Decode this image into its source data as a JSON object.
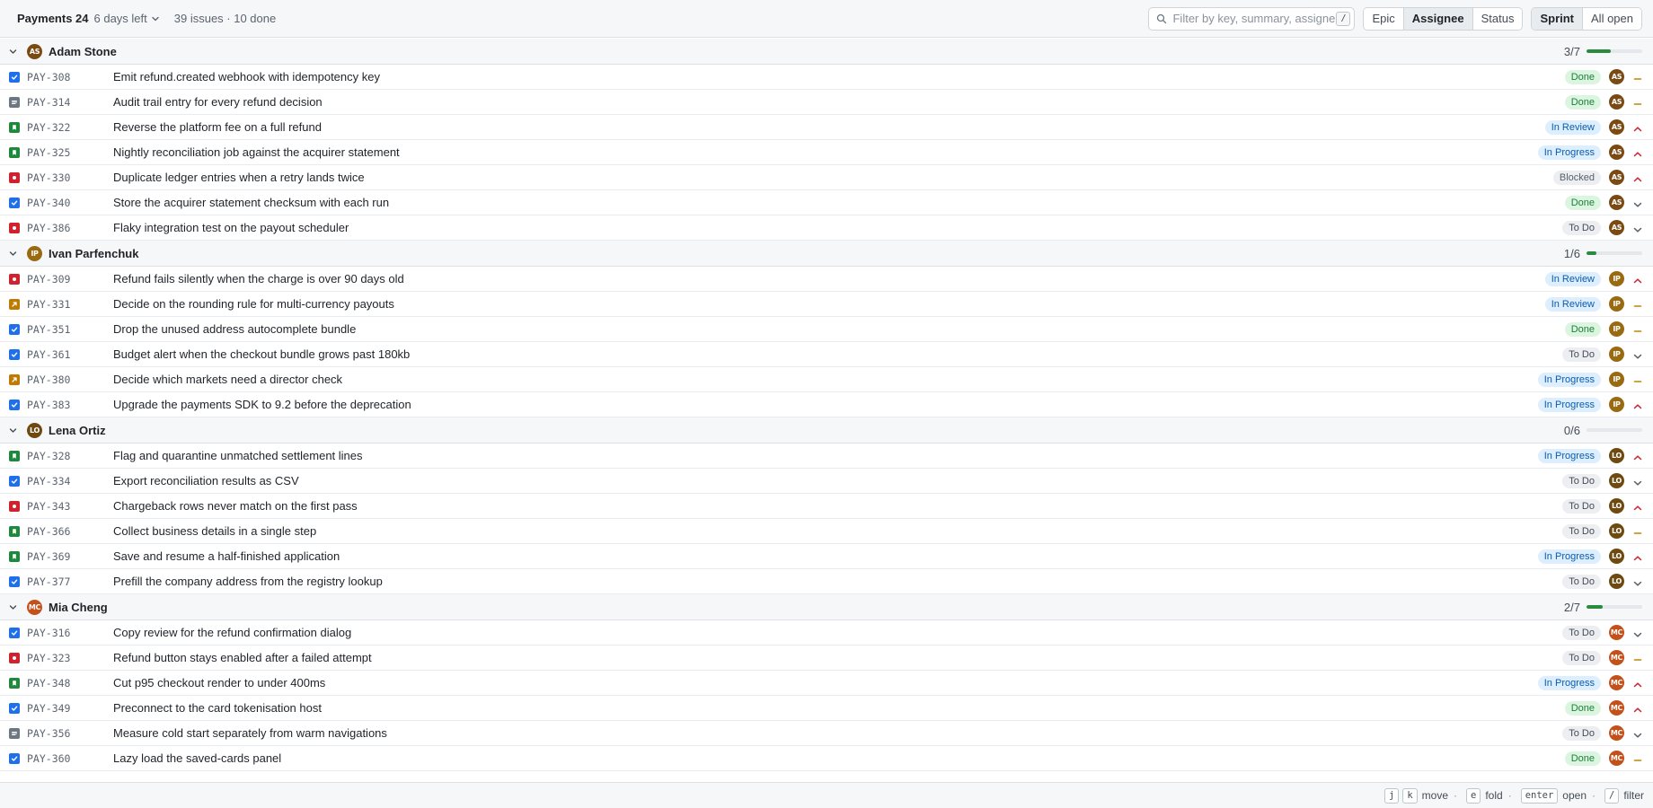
{
  "header": {
    "sprint_name": "Payments 24",
    "days_left": "6 days left",
    "issue_summary": "39 issues · 10 done",
    "filter_placeholder": "Filter by key, summary, assignee",
    "filter_shortcut": "/",
    "group_by": [
      "Epic",
      "Assignee",
      "Status"
    ],
    "group_by_active": "Assignee",
    "scope": [
      "Sprint",
      "All open"
    ],
    "scope_active": "Sprint"
  },
  "colors": {
    "done": "#1a7f37",
    "in_progress": "#0b5cad",
    "avatar_AS": "#7a4a12",
    "avatar_IP": "#9a6a12",
    "avatar_LO": "#6e4a10",
    "avatar_MC": "#c4501a",
    "priority_high": "#cf222e",
    "priority_medium": "#bf8700",
    "priority_low": "#57606a"
  },
  "groups": [
    {
      "name": "Adam Stone",
      "initials": "AS",
      "avatar_color": "#7a4a12",
      "count_label": "3/7",
      "progress": 0.43,
      "issues": [
        {
          "type": "task",
          "key": "PAY-308",
          "summary": "Emit refund.created webhook with idempotency key",
          "status": "Done",
          "priority": "medium"
        },
        {
          "type": "subtask",
          "key": "PAY-314",
          "summary": "Audit trail entry for every refund decision",
          "status": "Done",
          "priority": "medium"
        },
        {
          "type": "story",
          "key": "PAY-322",
          "summary": "Reverse the platform fee on a full refund",
          "status": "In Review",
          "priority": "high"
        },
        {
          "type": "story",
          "key": "PAY-325",
          "summary": "Nightly reconciliation job against the acquirer statement",
          "status": "In Progress",
          "priority": "high"
        },
        {
          "type": "bug",
          "key": "PAY-330",
          "summary": "Duplicate ledger entries when a retry lands twice",
          "status": "Blocked",
          "priority": "high"
        },
        {
          "type": "task",
          "key": "PAY-340",
          "summary": "Store the acquirer statement checksum with each run",
          "status": "Done",
          "priority": "low"
        },
        {
          "type": "bug",
          "key": "PAY-386",
          "summary": "Flaky integration test on the payout scheduler",
          "status": "To Do",
          "priority": "low"
        }
      ]
    },
    {
      "name": "Ivan Parfenchuk",
      "initials": "IP",
      "avatar_color": "#9a6a12",
      "count_label": "1/6",
      "progress": 0.17,
      "issues": [
        {
          "type": "bug",
          "key": "PAY-309",
          "summary": "Refund fails silently when the charge is over 90 days old",
          "status": "In Review",
          "priority": "high"
        },
        {
          "type": "decision",
          "key": "PAY-331",
          "summary": "Decide on the rounding rule for multi-currency payouts",
          "status": "In Review",
          "priority": "medium"
        },
        {
          "type": "task",
          "key": "PAY-351",
          "summary": "Drop the unused address autocomplete bundle",
          "status": "Done",
          "priority": "medium"
        },
        {
          "type": "task",
          "key": "PAY-361",
          "summary": "Budget alert when the checkout bundle grows past 180kb",
          "status": "To Do",
          "priority": "low"
        },
        {
          "type": "decision",
          "key": "PAY-380",
          "summary": "Decide which markets need a director check",
          "status": "In Progress",
          "priority": "medium"
        },
        {
          "type": "task",
          "key": "PAY-383",
          "summary": "Upgrade the payments SDK to 9.2 before the deprecation",
          "status": "In Progress",
          "priority": "high"
        }
      ]
    },
    {
      "name": "Lena Ortiz",
      "initials": "LO",
      "avatar_color": "#6e4a10",
      "count_label": "0/6",
      "progress": 0,
      "issues": [
        {
          "type": "story",
          "key": "PAY-328",
          "summary": "Flag and quarantine unmatched settlement lines",
          "status": "In Progress",
          "priority": "high"
        },
        {
          "type": "task",
          "key": "PAY-334",
          "summary": "Export reconciliation results as CSV",
          "status": "To Do",
          "priority": "low"
        },
        {
          "type": "bug",
          "key": "PAY-343",
          "summary": "Chargeback rows never match on the first pass",
          "status": "To Do",
          "priority": "high"
        },
        {
          "type": "story",
          "key": "PAY-366",
          "summary": "Collect business details in a single step",
          "status": "To Do",
          "priority": "medium"
        },
        {
          "type": "story",
          "key": "PAY-369",
          "summary": "Save and resume a half-finished application",
          "status": "In Progress",
          "priority": "high"
        },
        {
          "type": "task",
          "key": "PAY-377",
          "summary": "Prefill the company address from the registry lookup",
          "status": "To Do",
          "priority": "low"
        }
      ]
    },
    {
      "name": "Mia Cheng",
      "initials": "MC",
      "avatar_color": "#c4501a",
      "count_label": "2/7",
      "progress": 0.29,
      "issues": [
        {
          "type": "task",
          "key": "PAY-316",
          "summary": "Copy review for the refund confirmation dialog",
          "status": "To Do",
          "priority": "low"
        },
        {
          "type": "bug",
          "key": "PAY-323",
          "summary": "Refund button stays enabled after a failed attempt",
          "status": "To Do",
          "priority": "medium"
        },
        {
          "type": "story",
          "key": "PAY-348",
          "summary": "Cut p95 checkout render to under 400ms",
          "status": "In Progress",
          "priority": "high"
        },
        {
          "type": "task",
          "key": "PAY-349",
          "summary": "Preconnect to the card tokenisation host",
          "status": "Done",
          "priority": "high"
        },
        {
          "type": "subtask",
          "key": "PAY-356",
          "summary": "Measure cold start separately from warm navigations",
          "status": "To Do",
          "priority": "low"
        },
        {
          "type": "task",
          "key": "PAY-360",
          "summary": "Lazy load the saved-cards panel",
          "status": "Done",
          "priority": "medium"
        }
      ]
    }
  ],
  "footer": {
    "hints": [
      {
        "keys": [
          "j",
          "k"
        ],
        "label": "move"
      },
      {
        "keys": [
          "e"
        ],
        "label": "fold"
      },
      {
        "keys": [
          "enter"
        ],
        "label": "open"
      },
      {
        "keys": [
          "/"
        ],
        "label": "filter"
      }
    ]
  }
}
